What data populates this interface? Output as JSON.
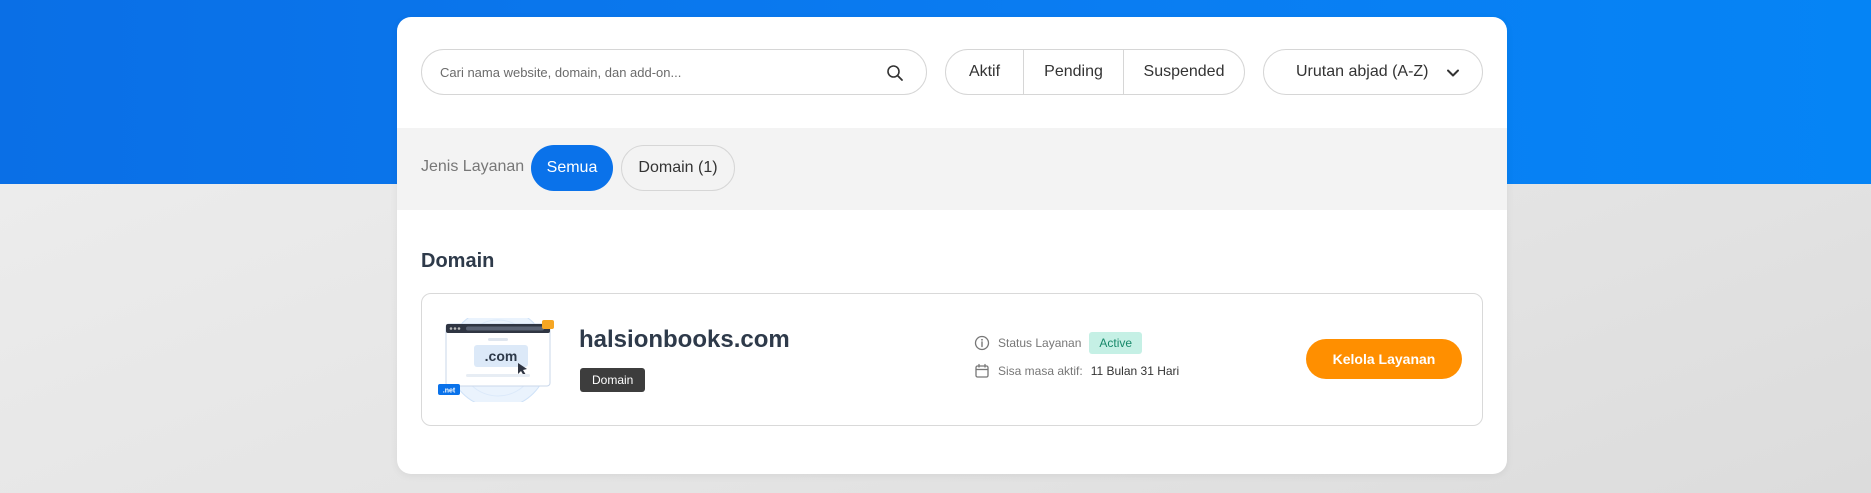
{
  "search": {
    "placeholder": "Cari nama website, domain, dan add-on...",
    "value": ""
  },
  "filters": {
    "status": [
      "Aktif",
      "Pending",
      "Suspended"
    ]
  },
  "sort": {
    "selected": "Urutan abjad (A-Z)"
  },
  "service_type": {
    "label": "Jenis Layanan",
    "options": [
      "Semua",
      "Domain (1)"
    ],
    "active": "Semua"
  },
  "section": {
    "title": "Domain"
  },
  "services": [
    {
      "name": "halsionbooks.com",
      "type_badge": "Domain",
      "status_label": "Status Layanan",
      "status_value": "Active",
      "remaining_label": "Sisa masa aktif:",
      "remaining_value": "11 Bulan 31 Hari",
      "action_label": "Kelola Layanan",
      "thumb_text": ".com",
      "thumb_badge": ".net"
    }
  ],
  "colors": {
    "primary": "#0a72ea",
    "action": "#ff8f00",
    "status_active_bg": "#c5f0e5",
    "status_active_text": "#17896a",
    "badge_dark": "#3d3d3d",
    "heading": "#2e3a4a"
  },
  "icons": {
    "search": "search-icon",
    "sort": "chevron-down-icon",
    "status": "info-icon",
    "remaining": "calendar-icon"
  }
}
